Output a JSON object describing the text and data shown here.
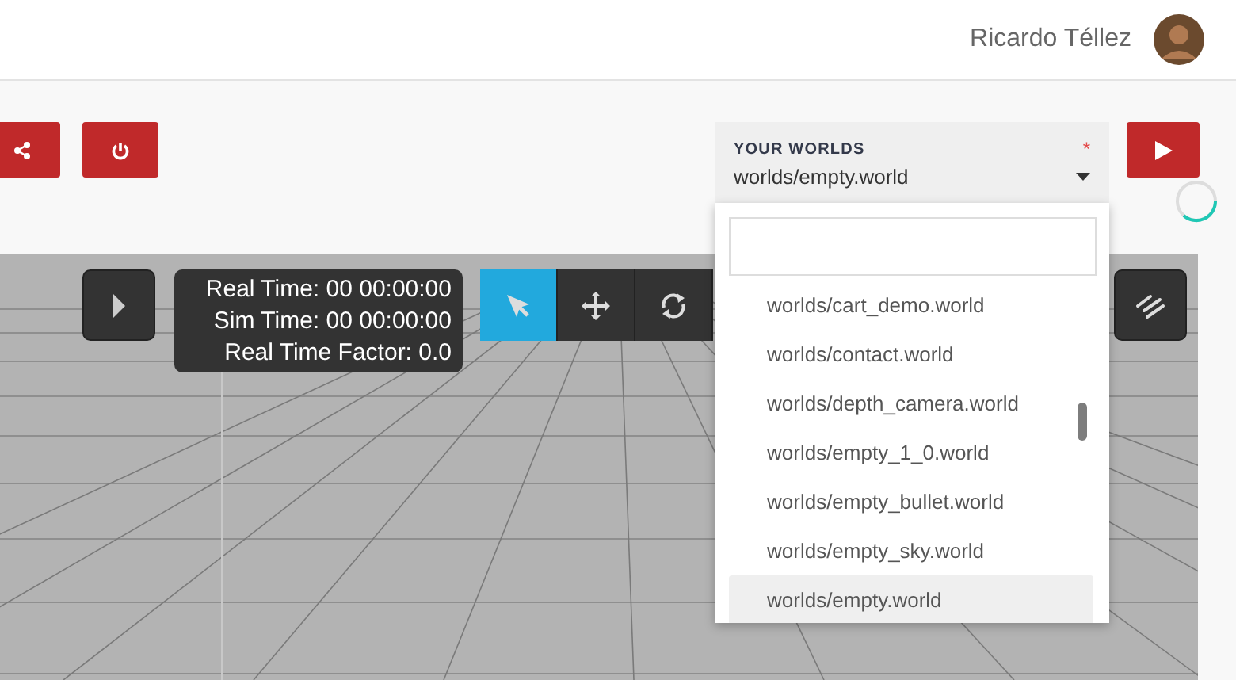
{
  "user": {
    "name": "Ricardo Téllez"
  },
  "actions": [
    {
      "kind": "share"
    },
    {
      "kind": "power"
    }
  ],
  "worlds_select": {
    "label": "YOUR WORLDS",
    "required_mark": "*",
    "value": "worlds/empty.world",
    "options": [
      {
        "label": "worlds/cart_demo.world",
        "selected": false
      },
      {
        "label": "worlds/contact.world",
        "selected": false
      },
      {
        "label": "worlds/depth_camera.world",
        "selected": false
      },
      {
        "label": "worlds/empty_1_0.world",
        "selected": false
      },
      {
        "label": "worlds/empty_bullet.world",
        "selected": false
      },
      {
        "label": "worlds/empty_sky.world",
        "selected": false
      },
      {
        "label": "worlds/empty.world",
        "selected": true
      }
    ]
  },
  "sim_stats": [
    "Real Time: 00 00:00:00",
    "Sim Time: 00 00:00:00",
    "Real Time Factor: 0.0"
  ],
  "tools": [
    {
      "kind": "select",
      "selected": true
    },
    {
      "kind": "translate",
      "selected": false
    },
    {
      "kind": "rotate",
      "selected": false
    }
  ]
}
